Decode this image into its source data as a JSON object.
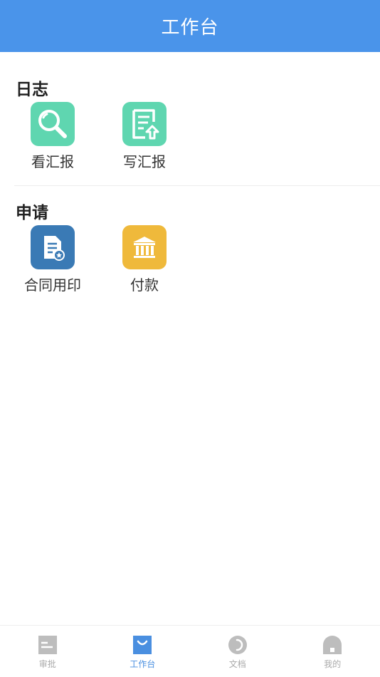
{
  "header": {
    "title": "工作台"
  },
  "sections": [
    {
      "title": "日志",
      "items": [
        {
          "label": "看汇报",
          "icon": "magnifier-icon",
          "color": "#5fd6b0"
        },
        {
          "label": "写汇报",
          "icon": "report-upload-icon",
          "color": "#5fd6b0"
        }
      ]
    },
    {
      "title": "申请",
      "items": [
        {
          "label": "合同用印",
          "icon": "contract-seal-icon",
          "color": "#3a7ab5"
        },
        {
          "label": "付款",
          "icon": "bank-icon",
          "color": "#efb93b"
        }
      ]
    }
  ],
  "tabbar": {
    "items": [
      {
        "label": "审批",
        "icon": "approval-icon",
        "active": false
      },
      {
        "label": "工作台",
        "icon": "workbench-icon",
        "active": true
      },
      {
        "label": "文档",
        "icon": "document-icon",
        "active": false
      },
      {
        "label": "我的",
        "icon": "profile-icon",
        "active": false
      }
    ],
    "active_color": "#4a8fe0",
    "inactive_color": "#aaaaaa"
  },
  "colors": {
    "primary": "#4a94ea"
  }
}
